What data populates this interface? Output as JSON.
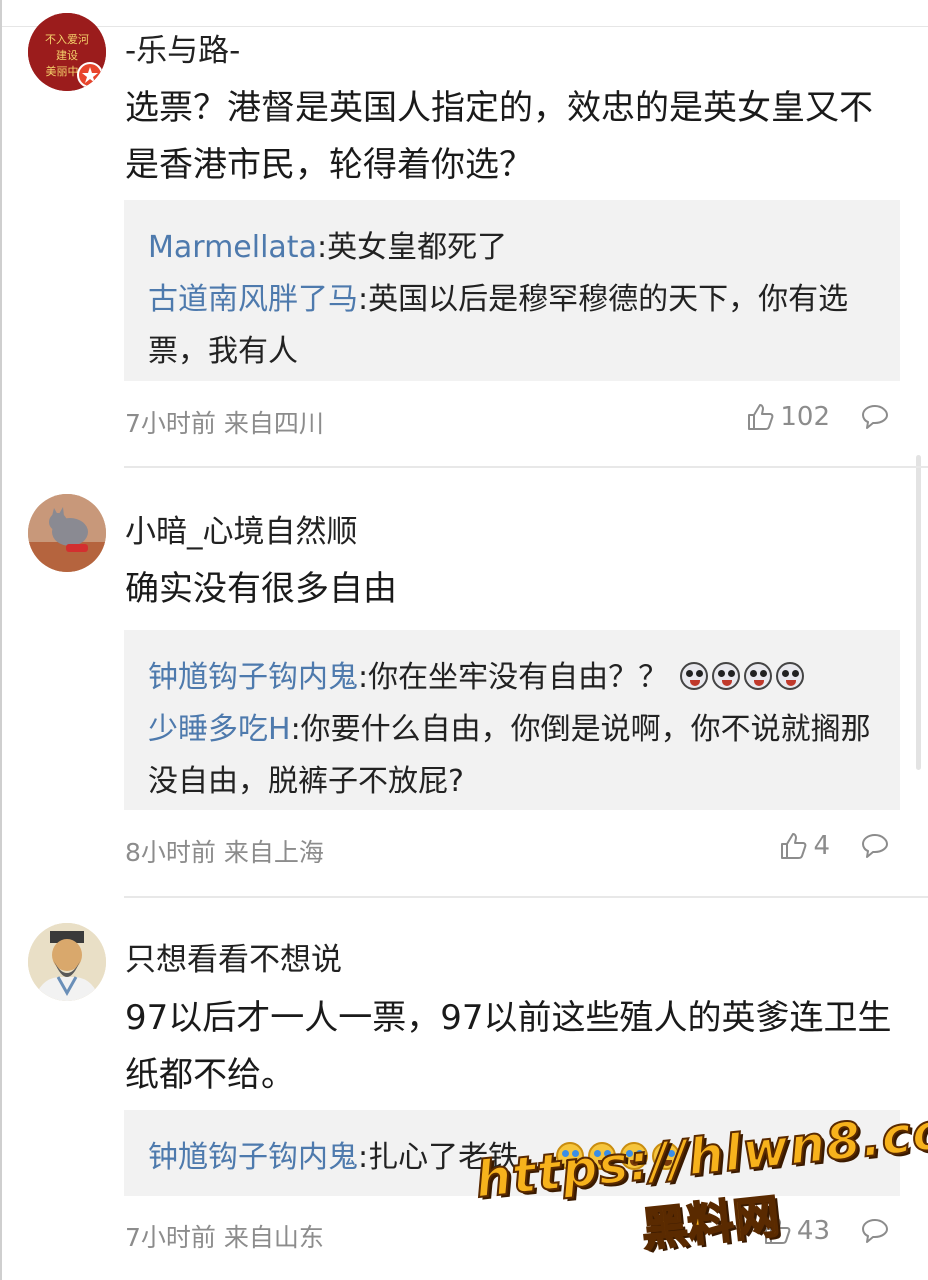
{
  "comments": [
    {
      "username": "-乐与路-",
      "avatar_text": "不入爱河 建设 美丽中",
      "text": "选票？港督是英国人指定的，效忠的是英女皇又不是香港市民，轮得着你选？",
      "replies": [
        {
          "user": "Marmellata",
          "text": ":英女皇都死了"
        },
        {
          "user": "古道南风胖了马",
          "text": ":英国以后是穆罕穆德的天下，你有选票，我有人"
        }
      ],
      "meta": "7小时前 来自四川",
      "likes": "102"
    },
    {
      "username": "小暗_心境自然顺",
      "text": "确实没有很多自由",
      "replies": [
        {
          "user": "钟馗钩子钩内鬼",
          "text": ":你在坐牢没有自由？？"
        },
        {
          "user": "少睡多吃H",
          "text": ":你要什么自由，你倒是说啊，你不说就搁那没自由，脱裤子不放屁?"
        }
      ],
      "meta": "8小时前 来自上海",
      "likes": "4"
    },
    {
      "username": "只想看看不想说",
      "text": "97以后才一人一票，97以前这些殖人的英爹连卫生纸都不给。",
      "replies": [
        {
          "user": "钟馗钩子钩内鬼",
          "text": ":扎心了老铁，"
        }
      ],
      "meta": "7小时前 来自山东",
      "likes": "43"
    }
  ],
  "watermark": {
    "url": "https://hlwn8.com",
    "name": "黑料网"
  },
  "icons": {
    "like": "thumbs-up-icon",
    "comment": "speech-bubble-icon",
    "emoji_shocked": "shocked-face-emoji-icon",
    "emoji_crying": "laugh-cry-emoji-icon"
  },
  "colors": {
    "reply_user": "#4e7aad",
    "reply_bg": "#f2f2f2",
    "meta": "#8c8c8c",
    "watermark": "#f7b21c"
  }
}
